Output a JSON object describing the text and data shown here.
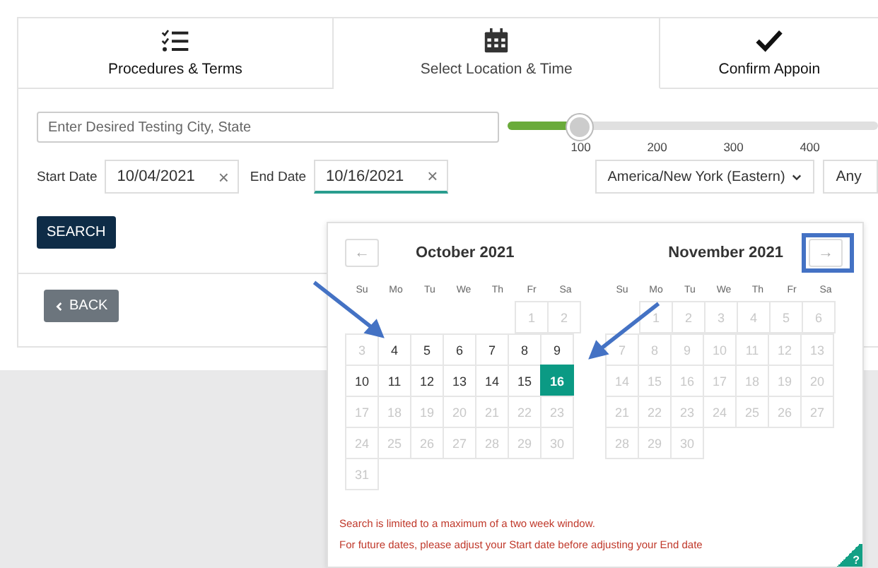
{
  "tabs": [
    {
      "label": "Procedures & Terms",
      "kind": "checklist",
      "selected": false
    },
    {
      "label": "Select Location & Time",
      "kind": "calendar",
      "selected": true
    },
    {
      "label": "Confirm Appoin",
      "kind": "check",
      "selected": false
    }
  ],
  "location": {
    "placeholder": "Enter Desired Testing City, State"
  },
  "distance": {
    "level": 0.19,
    "ticks": [
      "100",
      "200",
      "300",
      "400"
    ]
  },
  "start_date": {
    "label": "Start Date",
    "value": "10/04/2021",
    "clear": "×"
  },
  "end_date": {
    "label": "End Date",
    "value": "10/16/2021",
    "clear": "×"
  },
  "timezone": {
    "value": "America/New York (Eastern)"
  },
  "time_filter": {
    "value": "Any"
  },
  "search_button": "SEARCH",
  "back_button": "BACK",
  "calendar": {
    "prev": "←",
    "next": "→",
    "months": [
      {
        "title": "October 2021",
        "weekdays": [
          "Su",
          "Mo",
          "Tu",
          "We",
          "Th",
          "Fr",
          "Sa"
        ],
        "weeks": [
          [
            {
              "kind": "blank"
            },
            {
              "kind": "blank"
            },
            {
              "kind": "blank"
            },
            {
              "kind": "blank"
            },
            {
              "kind": "blank"
            },
            {
              "kind": "day",
              "day": "1",
              "disabled": true,
              "selected": false
            },
            {
              "kind": "day",
              "day": "2",
              "disabled": true,
              "selected": false
            }
          ],
          [
            {
              "kind": "day",
              "day": "3",
              "disabled": true,
              "selected": false
            },
            {
              "kind": "day",
              "day": "4",
              "disabled": false,
              "selected": false
            },
            {
              "kind": "day",
              "day": "5",
              "disabled": false,
              "selected": false
            },
            {
              "kind": "day",
              "day": "6",
              "disabled": false,
              "selected": false
            },
            {
              "kind": "day",
              "day": "7",
              "disabled": false,
              "selected": false
            },
            {
              "kind": "day",
              "day": "8",
              "disabled": false,
              "selected": false
            },
            {
              "kind": "day",
              "day": "9",
              "disabled": false,
              "selected": false
            }
          ],
          [
            {
              "kind": "day",
              "day": "10",
              "disabled": false,
              "selected": false
            },
            {
              "kind": "day",
              "day": "11",
              "disabled": false,
              "selected": false
            },
            {
              "kind": "day",
              "day": "12",
              "disabled": false,
              "selected": false
            },
            {
              "kind": "day",
              "day": "13",
              "disabled": false,
              "selected": false
            },
            {
              "kind": "day",
              "day": "14",
              "disabled": false,
              "selected": false
            },
            {
              "kind": "day",
              "day": "15",
              "disabled": false,
              "selected": false
            },
            {
              "kind": "day",
              "day": "16",
              "disabled": false,
              "selected": true
            }
          ],
          [
            {
              "kind": "day",
              "day": "17",
              "disabled": true,
              "selected": false
            },
            {
              "kind": "day",
              "day": "18",
              "disabled": true,
              "selected": false
            },
            {
              "kind": "day",
              "day": "19",
              "disabled": true,
              "selected": false
            },
            {
              "kind": "day",
              "day": "20",
              "disabled": true,
              "selected": false
            },
            {
              "kind": "day",
              "day": "21",
              "disabled": true,
              "selected": false
            },
            {
              "kind": "day",
              "day": "22",
              "disabled": true,
              "selected": false
            },
            {
              "kind": "day",
              "day": "23",
              "disabled": true,
              "selected": false
            }
          ],
          [
            {
              "kind": "day",
              "day": "24",
              "disabled": true,
              "selected": false
            },
            {
              "kind": "day",
              "day": "25",
              "disabled": true,
              "selected": false
            },
            {
              "kind": "day",
              "day": "26",
              "disabled": true,
              "selected": false
            },
            {
              "kind": "day",
              "day": "27",
              "disabled": true,
              "selected": false
            },
            {
              "kind": "day",
              "day": "28",
              "disabled": true,
              "selected": false
            },
            {
              "kind": "day",
              "day": "29",
              "disabled": true,
              "selected": false
            },
            {
              "kind": "day",
              "day": "30",
              "disabled": true,
              "selected": false
            }
          ],
          [
            {
              "kind": "day",
              "day": "31",
              "disabled": true,
              "selected": false
            }
          ]
        ]
      },
      {
        "title": "November 2021",
        "weekdays": [
          "Su",
          "Mo",
          "Tu",
          "We",
          "Th",
          "Fr",
          "Sa"
        ],
        "weeks": [
          [
            {
              "kind": "blank"
            },
            {
              "kind": "day",
              "day": "1",
              "disabled": true,
              "selected": false
            },
            {
              "kind": "day",
              "day": "2",
              "disabled": true,
              "selected": false
            },
            {
              "kind": "day",
              "day": "3",
              "disabled": true,
              "selected": false
            },
            {
              "kind": "day",
              "day": "4",
              "disabled": true,
              "selected": false
            },
            {
              "kind": "day",
              "day": "5",
              "disabled": true,
              "selected": false
            },
            {
              "kind": "day",
              "day": "6",
              "disabled": true,
              "selected": false
            }
          ],
          [
            {
              "kind": "day",
              "day": "7",
              "disabled": true,
              "selected": false
            },
            {
              "kind": "day",
              "day": "8",
              "disabled": true,
              "selected": false
            },
            {
              "kind": "day",
              "day": "9",
              "disabled": true,
              "selected": false
            },
            {
              "kind": "day",
              "day": "10",
              "disabled": true,
              "selected": false
            },
            {
              "kind": "day",
              "day": "11",
              "disabled": true,
              "selected": false
            },
            {
              "kind": "day",
              "day": "12",
              "disabled": true,
              "selected": false
            },
            {
              "kind": "day",
              "day": "13",
              "disabled": true,
              "selected": false
            }
          ],
          [
            {
              "kind": "day",
              "day": "14",
              "disabled": true,
              "selected": false
            },
            {
              "kind": "day",
              "day": "15",
              "disabled": true,
              "selected": false
            },
            {
              "kind": "day",
              "day": "16",
              "disabled": true,
              "selected": false
            },
            {
              "kind": "day",
              "day": "17",
              "disabled": true,
              "selected": false
            },
            {
              "kind": "day",
              "day": "18",
              "disabled": true,
              "selected": false
            },
            {
              "kind": "day",
              "day": "19",
              "disabled": true,
              "selected": false
            },
            {
              "kind": "day",
              "day": "20",
              "disabled": true,
              "selected": false
            }
          ],
          [
            {
              "kind": "day",
              "day": "21",
              "disabled": true,
              "selected": false
            },
            {
              "kind": "day",
              "day": "22",
              "disabled": true,
              "selected": false
            },
            {
              "kind": "day",
              "day": "23",
              "disabled": true,
              "selected": false
            },
            {
              "kind": "day",
              "day": "24",
              "disabled": true,
              "selected": false
            },
            {
              "kind": "day",
              "day": "25",
              "disabled": true,
              "selected": false
            },
            {
              "kind": "day",
              "day": "26",
              "disabled": true,
              "selected": false
            },
            {
              "kind": "day",
              "day": "27",
              "disabled": true,
              "selected": false
            }
          ],
          [
            {
              "kind": "day",
              "day": "28",
              "disabled": true,
              "selected": false
            },
            {
              "kind": "day",
              "day": "29",
              "disabled": true,
              "selected": false
            },
            {
              "kind": "day",
              "day": "30",
              "disabled": true,
              "selected": false
            }
          ]
        ]
      }
    ],
    "messages": [
      "Search is limited to a maximum of a two week window.",
      "For future dates, please adjust your Start date before adjusting your End date"
    ],
    "help": "?"
  }
}
